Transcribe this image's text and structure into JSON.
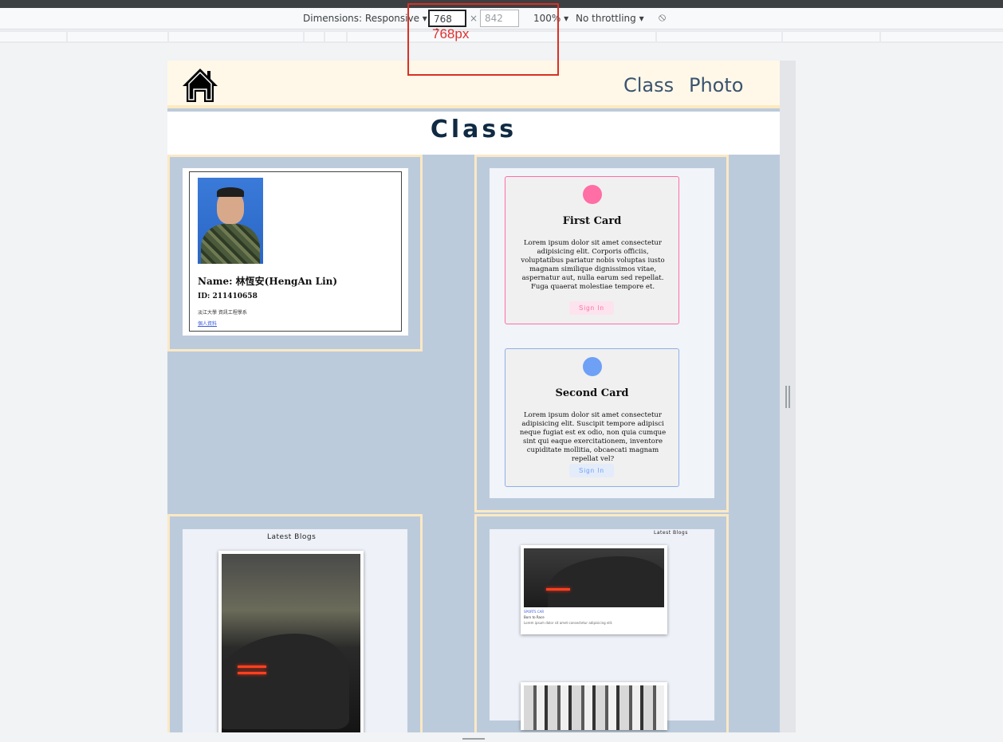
{
  "devtools": {
    "dimensions_label": "Dimensions: Responsive",
    "width_value": "768",
    "times": "×",
    "height_value": "842",
    "zoom": "100%",
    "throttling": "No throttling",
    "width_overlay": "768px"
  },
  "site": {
    "nav": {
      "links": [
        "Class",
        "Photo"
      ]
    },
    "page_title": "Class",
    "profile": {
      "name": "Name: 林恆安(HengAn Lin)",
      "id": "ID: 211410658",
      "dept": "淡江大學 資訊工程學系",
      "link": "個人資料"
    },
    "cards": [
      {
        "title": "First Card",
        "text": "Lorem ipsum dolor sit amet consectetur adipisicing elit. Corporis officiis, voluptatibus pariatur nobis voluptas iusto magnam similique dignissimos vitae, aspernatur aut, nulla earum sed repellat. Fuga quaerat molestiae tempore et.",
        "button": "Sign In",
        "color": "#ff6ea5"
      },
      {
        "title": "Second Card",
        "text": "Lorem ipsum dolor sit amet consectetur adipisicing elit. Suscipit tempore adipisci neque fugiat est ex odio, non quia cumque sint qui eaque exercitationem, inventore cupiditate mollitia, obcaecati magnam repellat vel?",
        "button": "Sign In",
        "color": "#6ea0f5"
      }
    ],
    "blogs_left": {
      "title": "Latest Blogs"
    },
    "blogs_right": {
      "title": "Latest Blogs",
      "post_tag": "SPORTS CAR",
      "post_title": "Born to Race",
      "post_text": "Lorem ipsum dolor sit amet consectetur adipisicing elit."
    }
  }
}
